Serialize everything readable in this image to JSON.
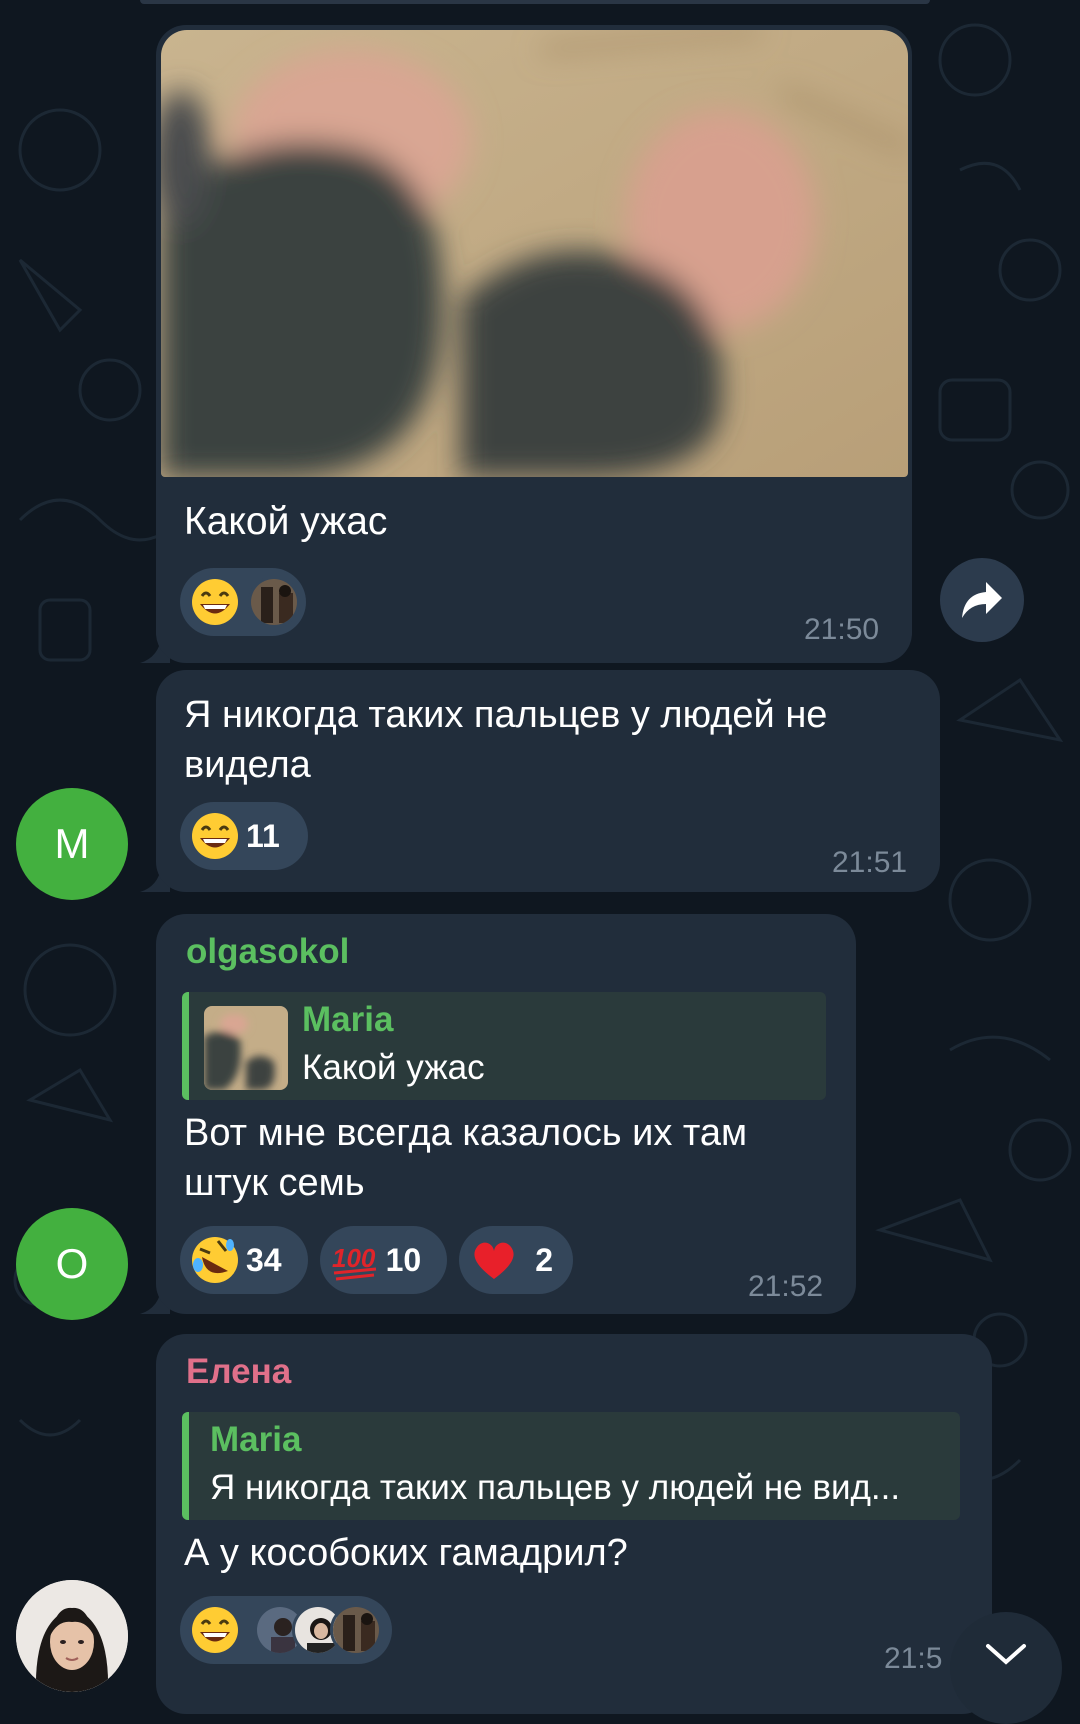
{
  "messages": [
    {
      "caption": "Какой ужас",
      "time": "21:50",
      "reactions": [
        {
          "emoji": "grinning-face"
        }
      ]
    },
    {
      "avatar_letter": "M",
      "text": [
        "Я никогда таких пальцев у людей не",
        "видела"
      ],
      "time": "21:51",
      "reactions": [
        {
          "emoji": "grinning-face",
          "count": "11"
        }
      ]
    },
    {
      "avatar_letter": "O",
      "sender": "olgasokol",
      "reply": {
        "name": "Maria",
        "text": "Какой ужас"
      },
      "text": [
        "Вот мне всегда казалось их там",
        "штук семь"
      ],
      "time": "21:52",
      "reactions": [
        {
          "emoji": "rolling-laughing-face",
          "count": "34"
        },
        {
          "emoji": "hundred-points",
          "count": "10"
        },
        {
          "emoji": "red-heart",
          "count": "2"
        }
      ]
    },
    {
      "sender": "Елена",
      "reply": {
        "name": "Maria",
        "text": "Я никогда таких пальцев у людей не вид..."
      },
      "text": [
        "А у кособоких гамадрил?"
      ],
      "time": "21:5",
      "reactions": [
        {
          "emoji": "grinning-face"
        }
      ]
    }
  ],
  "colors": {
    "bubble": "#212d3b",
    "background": "#0f1720",
    "accent_green": "#5bbf60",
    "sender_pink": "#e0708a",
    "time": "#7c8a99",
    "avatar_green": "#43b03f"
  },
  "icons": [
    "share-arrow-icon",
    "chevron-down-icon"
  ]
}
